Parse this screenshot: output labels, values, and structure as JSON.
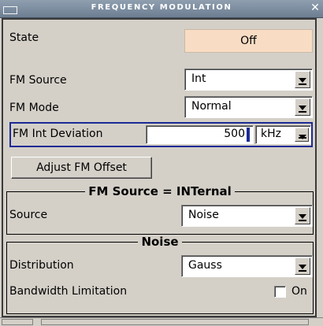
{
  "window": {
    "title": "FREQUENCY MODULATION"
  },
  "state": {
    "label": "State",
    "value": "Off"
  },
  "fm_source": {
    "label": "FM Source",
    "value": "Int"
  },
  "fm_mode": {
    "label": "FM Mode",
    "value": "Normal"
  },
  "fm_int_deviation": {
    "label": "FM Int Deviation",
    "value": "500",
    "unit": "kHz"
  },
  "adjust_button": {
    "label": "Adjust FM Offset"
  },
  "internal_section": {
    "title": "FM Source = INTernal",
    "source_label": "Source",
    "source_value": "Noise"
  },
  "noise_section": {
    "title": "Noise",
    "distribution_label": "Distribution",
    "distribution_value": "Gauss",
    "bandwidth_label": "Bandwidth Limitation",
    "bandwidth_value": "On",
    "bandwidth_checked": false
  },
  "colors": {
    "title_bar": "#7a8a9c",
    "state_button": "#f9dcc4",
    "focus_border": "#1c2a94",
    "panel_bg": "#d4d0c8"
  },
  "icons": {
    "window_icon": "window-icon",
    "close": "close-icon",
    "dropdown": "chevron-down-icon"
  }
}
